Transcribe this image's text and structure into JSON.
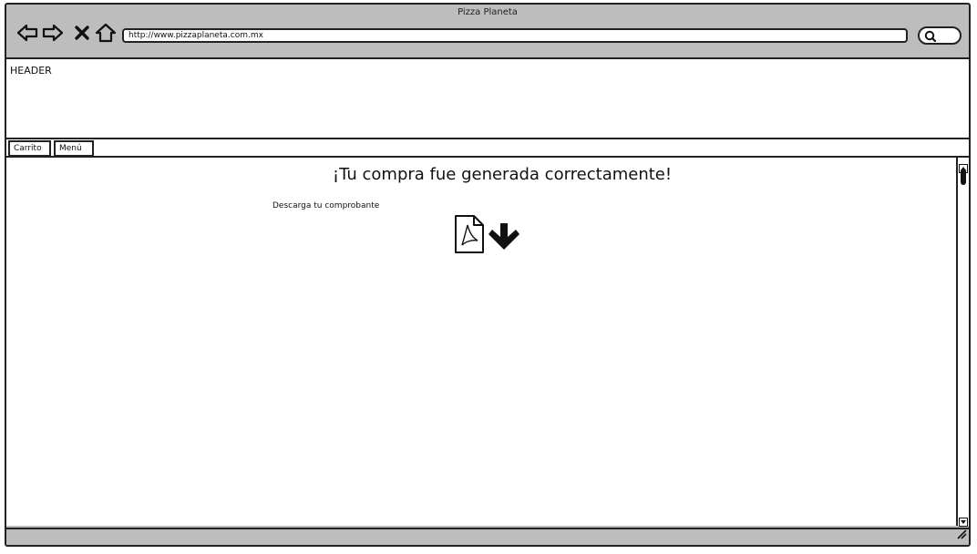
{
  "browser": {
    "window_title": "Pizza Planeta",
    "url": "http://www.pizzaplaneta.com.mx",
    "nav_icons": [
      "back-arrow-icon",
      "forward-arrow-icon",
      "close-x-icon",
      "home-icon"
    ],
    "search_icon": "search-icon"
  },
  "page": {
    "header_label": "HEADER",
    "tabs": [
      {
        "label": "Carrito"
      },
      {
        "label": "Menú"
      }
    ],
    "main": {
      "heading": "¡Tu compra fue generada correctamente!",
      "download_label": "Descarga tu comprobante",
      "download_icons": [
        "pdf-file-icon",
        "download-arrow-icon"
      ]
    }
  },
  "colors": {
    "chrome": "#bdbdbd",
    "outline": "#222222",
    "page_bg": "#ffffff"
  }
}
